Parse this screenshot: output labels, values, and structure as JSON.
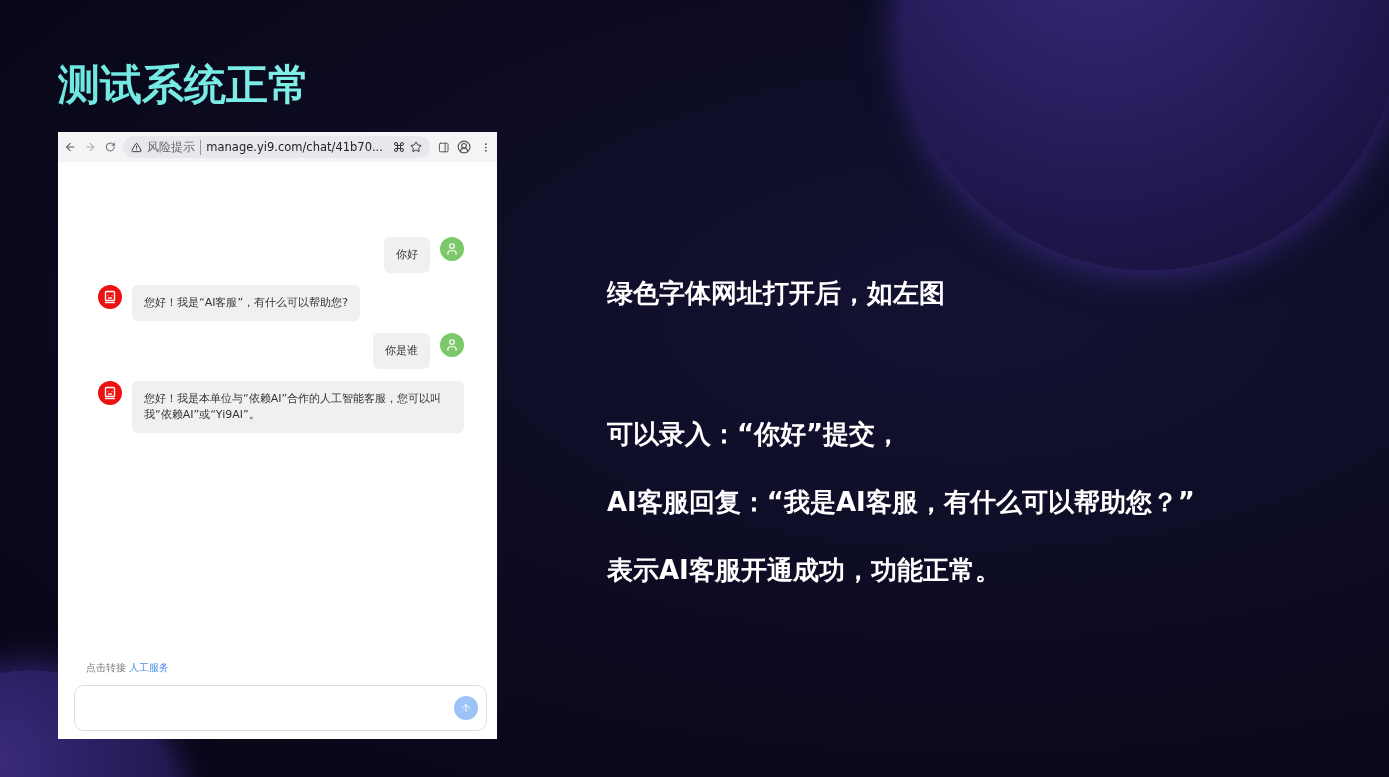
{
  "title": "测试系统正常",
  "browser": {
    "warning": "风险提示",
    "url": "manage.yi9.com/chat/41b70..."
  },
  "messages": [
    {
      "kind": "user",
      "text": "你好"
    },
    {
      "kind": "bot",
      "text": "您好！我是“AI客服”，有什么可以帮助您?"
    },
    {
      "kind": "user",
      "text": "你是谁"
    },
    {
      "kind": "bot",
      "text": "您好！我是本单位与“依赖AI”合作的人工智能客服，您可以叫我“依赖AI”或“Yi9AI”。"
    }
  ],
  "transfer": {
    "text": "点击转接",
    "link": "人工服务"
  },
  "notes": [
    "绿色字体网址打开后，如左图",
    "可以录入：“你好”提交，",
    "AI客服回复：“我是AI客服，有什么可以帮助您？”",
    "表示AI客服开通成功，功能正常。"
  ]
}
